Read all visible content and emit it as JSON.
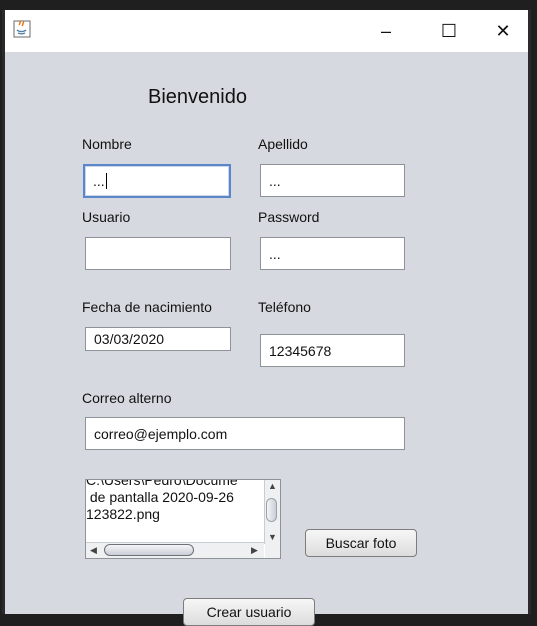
{
  "window": {
    "controls": {
      "minimize": "–",
      "maximize": "☐",
      "close": "✕"
    }
  },
  "form": {
    "title": "Bienvenido",
    "labels": {
      "nombre": "Nombre",
      "apellido": "Apellido",
      "usuario": "Usuario",
      "password": "Password",
      "fecha": "Fecha de nacimiento",
      "telefono": "Teléfono",
      "correo": "Correo alterno"
    },
    "values": {
      "nombre": "...",
      "apellido": "...",
      "usuario": "",
      "password": "...",
      "fecha": "03/03/2020",
      "telefono": "12345678",
      "correo": "correo@ejemplo.com"
    },
    "photo_path": {
      "line1": "C:\\Users\\Pedro\\Docume",
      "line2": " de pantalla 2020-09-26",
      "line3": "123822.png"
    },
    "buttons": {
      "buscar_foto": "Buscar foto",
      "crear_usuario": "Crear usuario"
    }
  }
}
